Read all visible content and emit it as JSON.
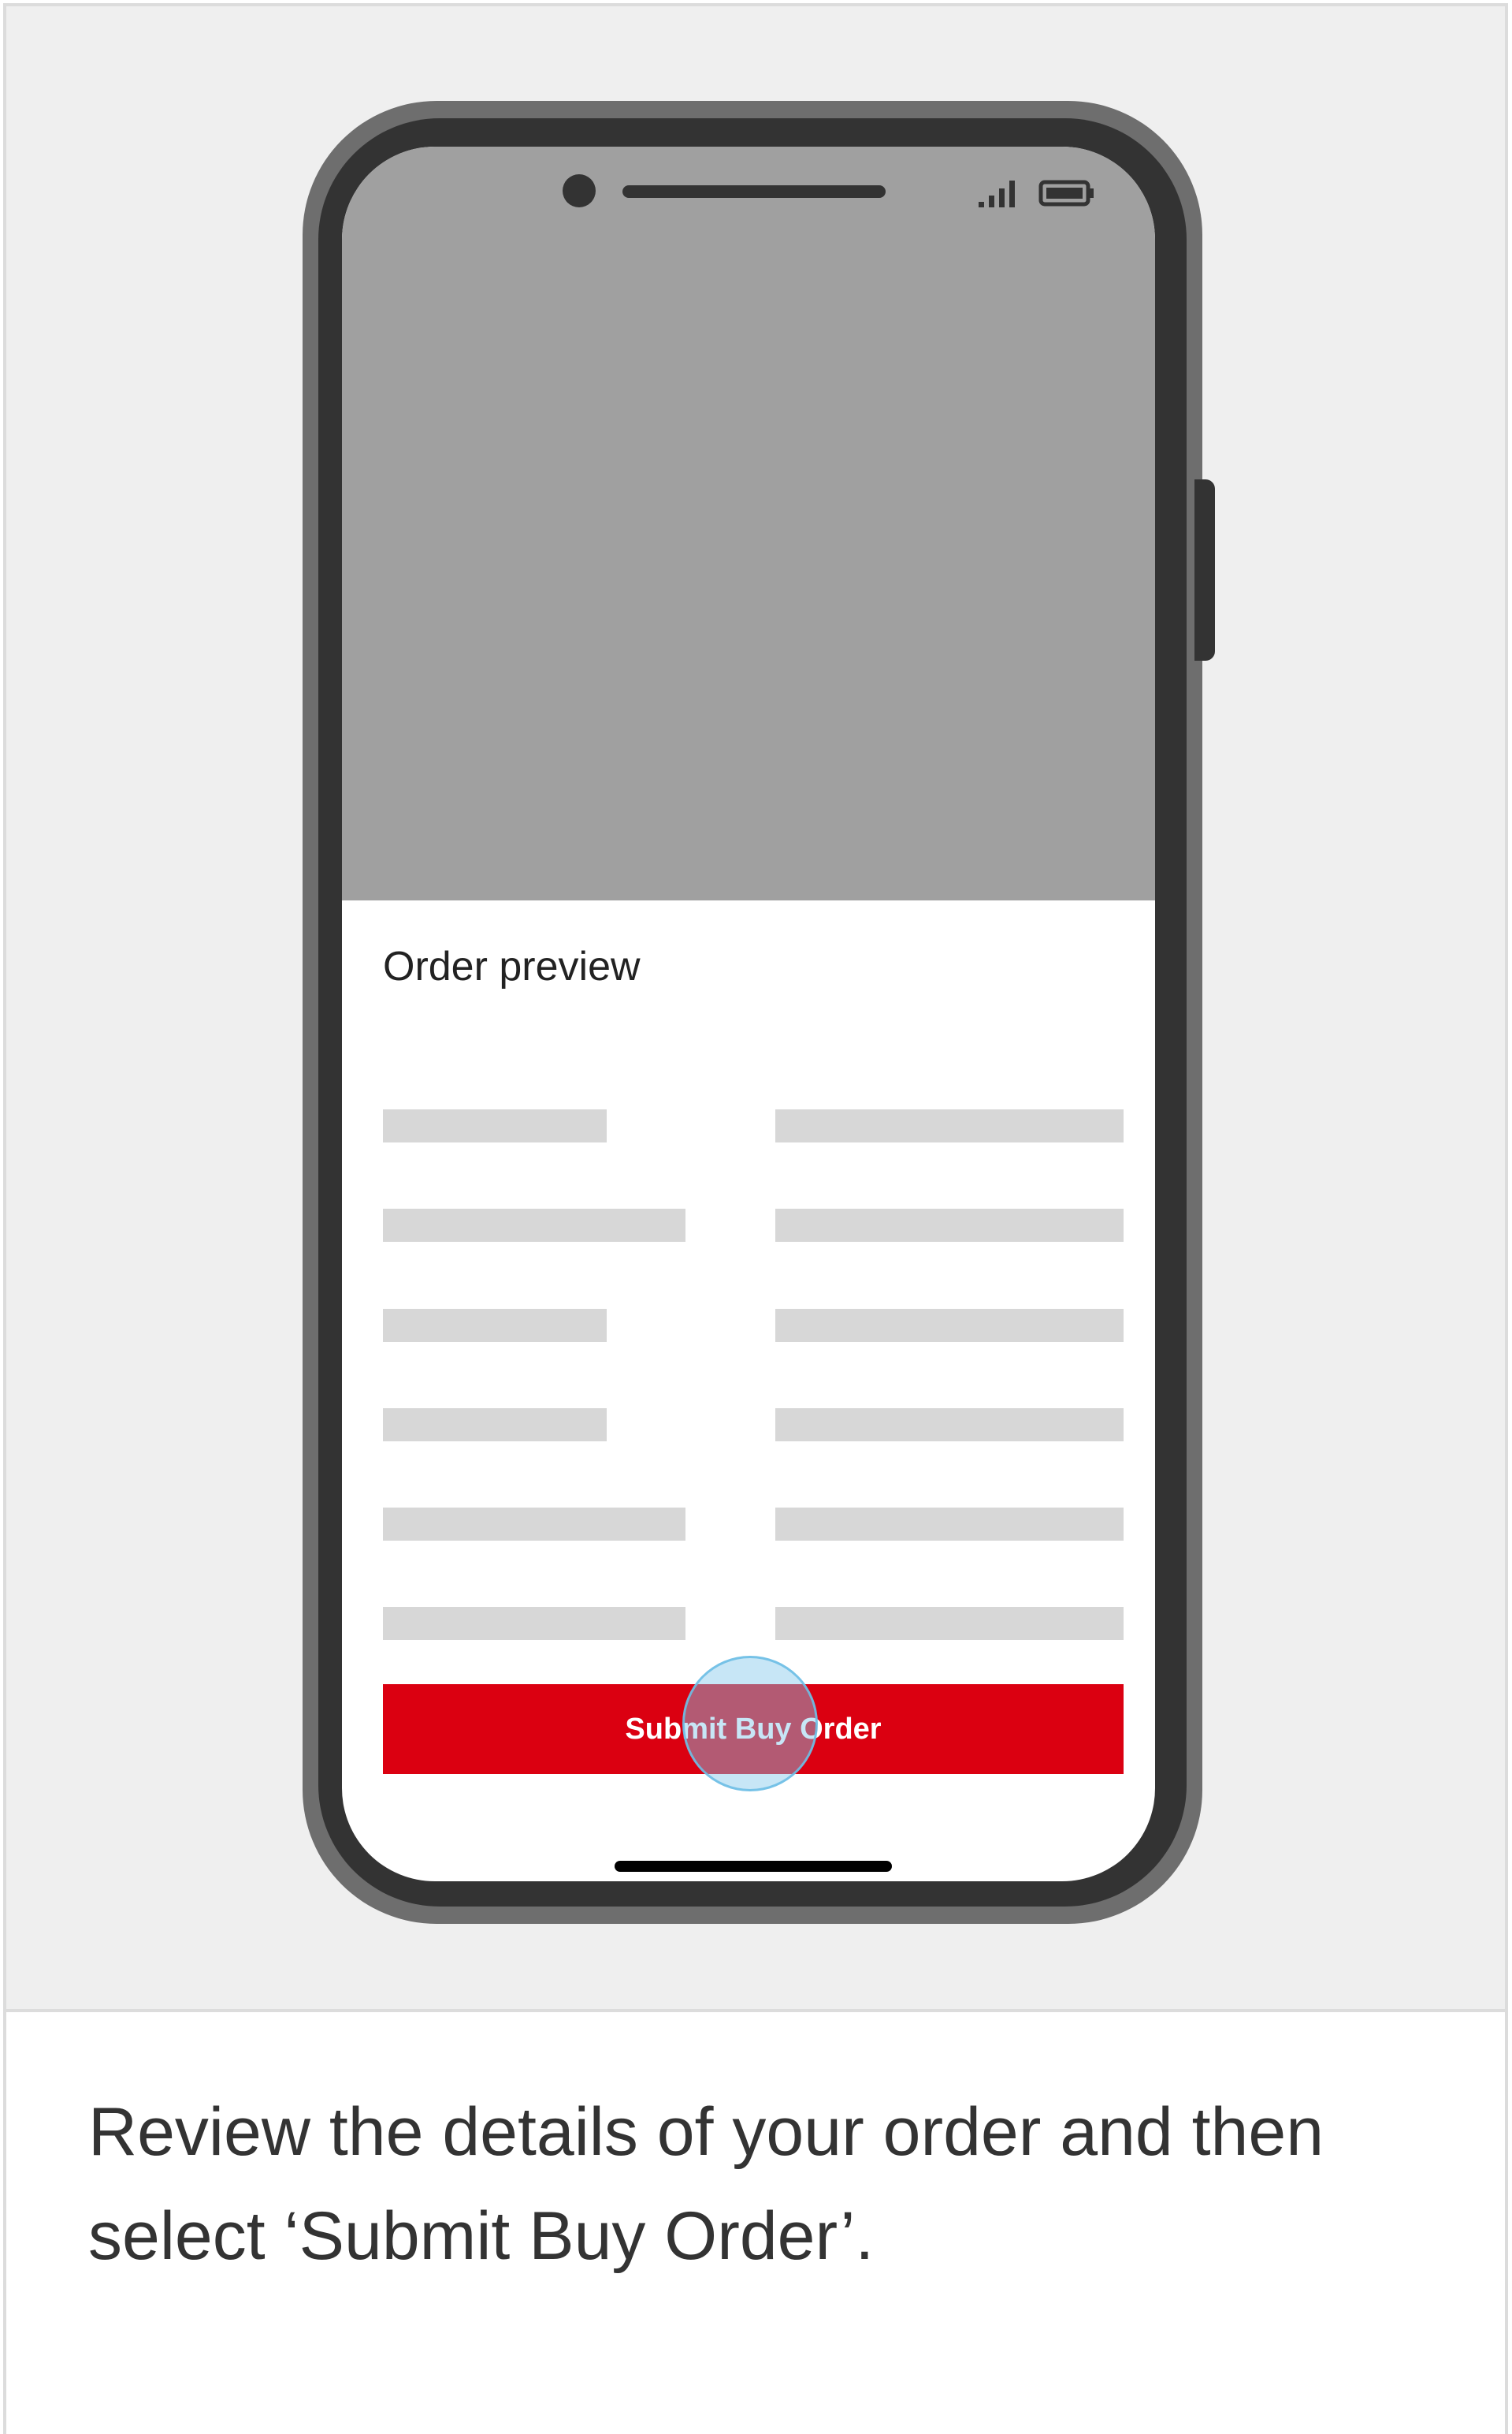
{
  "phone": {
    "status_bar": {
      "icons": [
        "signal-icon",
        "battery-icon"
      ]
    },
    "order_preview": {
      "title": "Order preview",
      "rows": 6
    },
    "submit_button": {
      "label": "Submit Buy Order",
      "color": "#db0011"
    }
  },
  "caption": {
    "text": "Review the details of your order and then select ‘Submit Buy Order’."
  },
  "colors": {
    "accent": "#db0011",
    "placeholder": "#d7d7d7",
    "screen_top": "#a0a0a0"
  }
}
